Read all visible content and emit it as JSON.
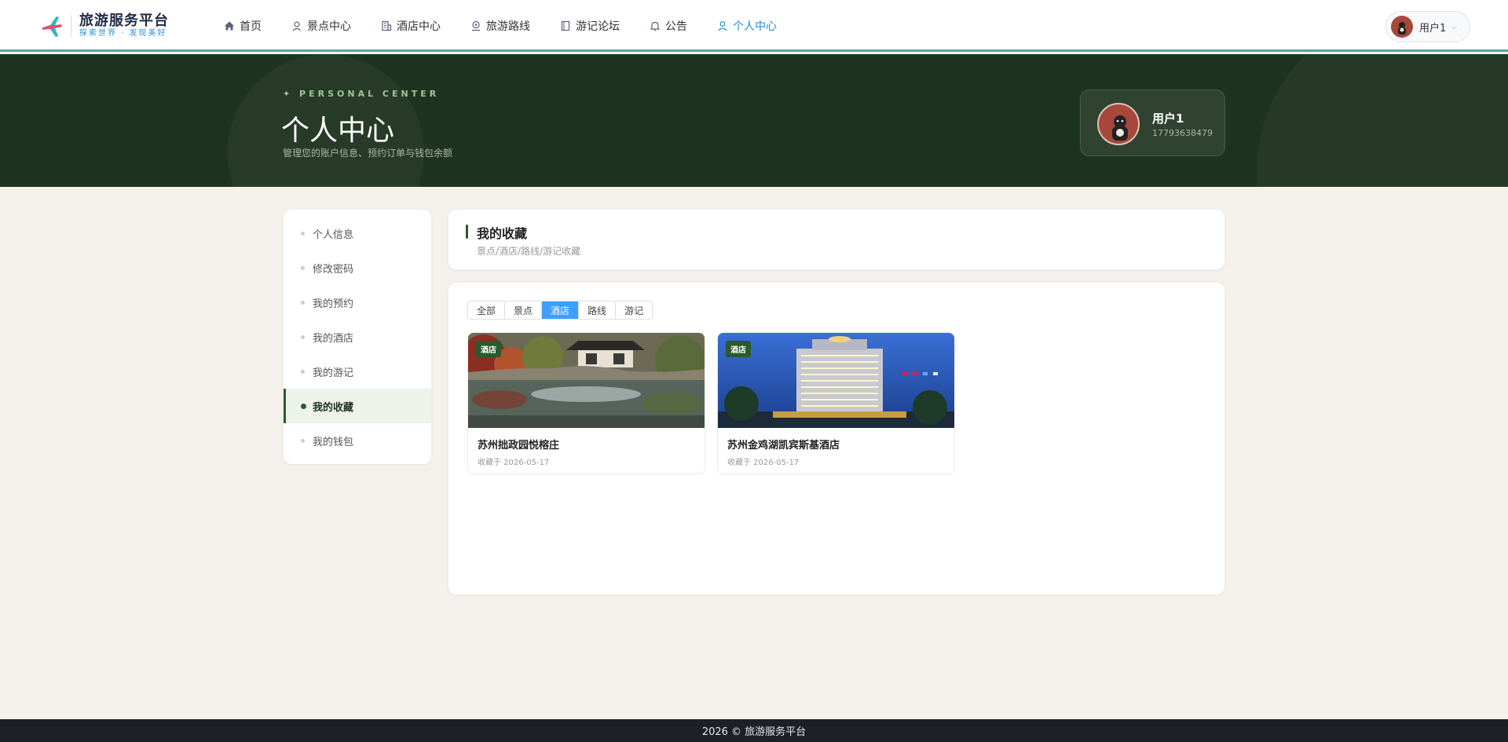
{
  "brand": {
    "name": "旅游服务平台",
    "slogan": "探索世界 · 发现美好"
  },
  "nav": {
    "items": [
      {
        "label": "首页",
        "icon": "home-icon"
      },
      {
        "label": "景点中心",
        "icon": "location-icon"
      },
      {
        "label": "酒店中心",
        "icon": "building-icon"
      },
      {
        "label": "旅游路线",
        "icon": "route-icon"
      },
      {
        "label": "游记论坛",
        "icon": "notebook-icon"
      },
      {
        "label": "公告",
        "icon": "bell-icon"
      },
      {
        "label": "个人中心",
        "icon": "user-icon"
      }
    ],
    "active": "个人中心",
    "user_label": "用户1"
  },
  "hero": {
    "eyebrow": "✦ PERSONAL CENTER",
    "title": "个人中心",
    "subtitle": "管理您的账户信息、预约订单与钱包余额",
    "user_name": "用户1",
    "user_phone": "17793638479"
  },
  "sidebar": {
    "items": [
      {
        "label": "个人信息"
      },
      {
        "label": "修改密码"
      },
      {
        "label": "我的预约"
      },
      {
        "label": "我的酒店"
      },
      {
        "label": "我的游记"
      },
      {
        "label": "我的收藏"
      },
      {
        "label": "我的钱包"
      }
    ],
    "active": "我的收藏"
  },
  "section": {
    "title": "我的收藏",
    "subtitle": "景点/酒店/路线/游记收藏"
  },
  "tabs": {
    "items": [
      "全部",
      "景点",
      "酒店",
      "路线",
      "游记"
    ],
    "active": "酒店"
  },
  "favorites": [
    {
      "badge": "酒店",
      "name": "苏州拙政园悦榕庄",
      "date": "收藏于 2026-05-17"
    },
    {
      "badge": "酒店",
      "name": "苏州金鸡湖凯宾斯基酒店",
      "date": "收藏于 2026-05-17"
    }
  ],
  "footer": {
    "text": "2026 © 旅游服务平台"
  },
  "colors": {
    "accent": "#1a8fd6",
    "hero_bg": "#1f3420",
    "brand_green": "#2b5a2e",
    "tab_active": "#409eff"
  }
}
